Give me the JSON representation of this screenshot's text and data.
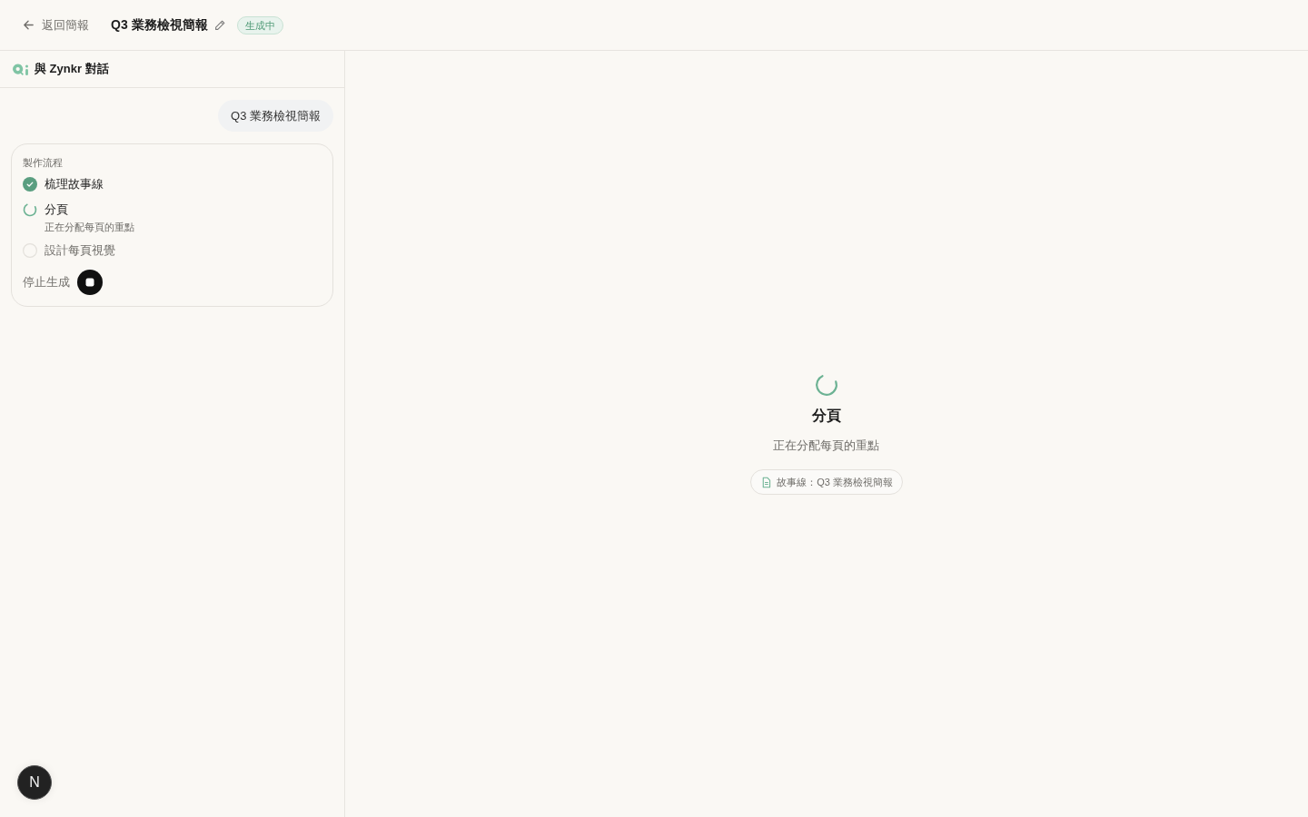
{
  "topbar": {
    "back_link": "返回簡報",
    "title": "Q3 業務檢視簡報",
    "status_badge": "生成中"
  },
  "chat": {
    "title": "與 Zynkr 對話",
    "messages": [
      {
        "from_user": true,
        "text": "Q3 業務檢視簡報"
      }
    ],
    "progress": {
      "heading": "製作流程",
      "steps": [
        {
          "label": "梳理故事線",
          "done": true,
          "active": false
        },
        {
          "label": "分頁",
          "detail": "正在分配每頁的重點",
          "done": false,
          "active": true
        },
        {
          "label": "設計每頁視覺",
          "done": false,
          "active": false
        }
      ],
      "stop_label": "停止生成"
    }
  },
  "preview": {
    "title": "分頁",
    "subtitle": "正在分配每頁的重點",
    "source_chip": "故事線：Q3 業務檢視簡報"
  },
  "dev_badge": "N"
}
